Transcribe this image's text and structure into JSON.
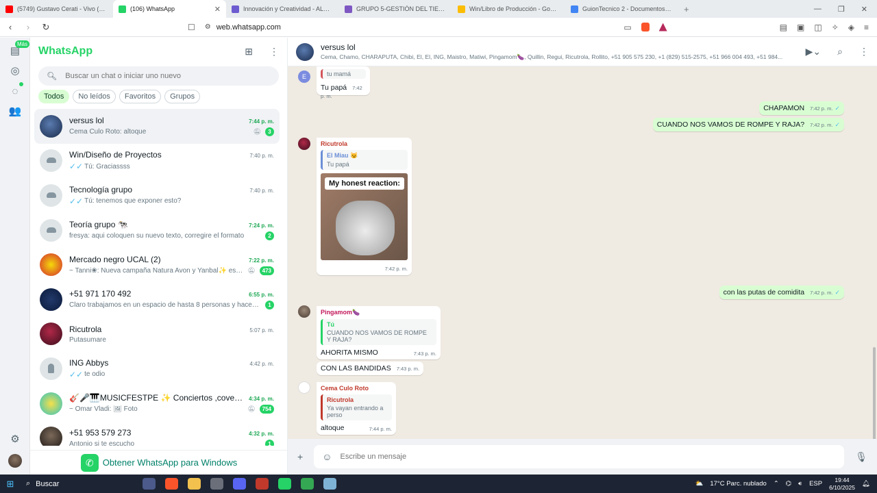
{
  "browser": {
    "tabs": [
      {
        "label": "(5749) Gustavo Cerati - Vivo (Oficial",
        "color": "#ff0000",
        "active": false
      },
      {
        "label": "(106) WhatsApp",
        "color": "#25d366",
        "active": true
      },
      {
        "label": "Innovación y Creatividad - ALUMNO",
        "color": "#6d5bd0",
        "active": false
      },
      {
        "label": "GRUPO 5-GESTIÓN DEL TIEMPO - Pr",
        "color": "#7e57c2",
        "active": false
      },
      {
        "label": "Win/Libro de Producción - Google D",
        "color": "#fbbc04",
        "active": false
      },
      {
        "label": "GuionTecnico 2 - Documentos de Go",
        "color": "#4285f4",
        "active": false
      }
    ],
    "url": "web.whatsapp.com"
  },
  "sidebar": {
    "title": "WhatsApp",
    "mas_badge": "Más",
    "search_placeholder": "Buscar un chat o iniciar uno nuevo",
    "filters": [
      "Todos",
      "No leídos",
      "Favoritos",
      "Grupos"
    ],
    "chats": [
      {
        "name": "versus lol",
        "time": "7:44 p. m.",
        "preview": "Cema Culo Roto: altoque",
        "badge": "3",
        "muted": true,
        "unread": true,
        "avatar": "radial-gradient(circle at 45% 40%, #5a7bb0, #1a2b4a)",
        "type": "img"
      },
      {
        "name": "Win/Diseño de Proyectos",
        "time": "7:40 p. m.",
        "preview": "Tú: Graciassss",
        "badge": "",
        "muted": false,
        "unread": false,
        "ticks": true,
        "type": "grp"
      },
      {
        "name": "Tecnología grupo",
        "time": "7:40 p. m.",
        "preview": "Tú: tenemos que exponer esto?",
        "badge": "",
        "muted": false,
        "unread": false,
        "ticks": true,
        "type": "grp"
      },
      {
        "name": "Teoría grupo 🐄",
        "time": "7:24 p. m.",
        "preview": "fresya: aqui coloquen su nuevo texto, corregire el formato",
        "badge": "2",
        "muted": false,
        "unread": true,
        "type": "grp"
      },
      {
        "name": "Mercado negro UCAL (2)",
        "time": "7:22 p. m.",
        "preview": "~ Tanni❀: Nueva campaña Natura Avon y Yanbal✨ escribe...",
        "badge": "473",
        "muted": true,
        "unread": true,
        "avatar": "radial-gradient(circle at 50% 50%, #f5d90a, #d4292f)",
        "type": "img"
      },
      {
        "name": "+51 971 170 492",
        "time": "6:55 p. m.",
        "preview": "Claro trabajamos en un espacio de hasta 8 personas y hacemos e...",
        "badge": "1",
        "muted": false,
        "unread": true,
        "avatar": "radial-gradient(circle at 50% 50%, #223a6b, #0b1a3a)",
        "type": "img"
      },
      {
        "name": "Ricutrola",
        "time": "5:07 p. m.",
        "preview": "Putasumare",
        "badge": "",
        "muted": false,
        "unread": false,
        "avatar": "radial-gradient(circle at 45% 40%, #b02848, #3a0e1c)",
        "type": "img"
      },
      {
        "name": "ING Abbys",
        "time": "4:42 p. m.",
        "preview": "te odio",
        "badge": "",
        "muted": false,
        "unread": false,
        "ticks": true,
        "type": "person"
      },
      {
        "name": "🎸🎤🎹MUSICFESTPE ✨ Conciertos ,covers nacio...",
        "time": "4:34 p. m.",
        "preview": "~ Omar Vladi: 🖼 Foto",
        "badge": "754",
        "muted": true,
        "unread": true,
        "avatar": "radial-gradient(circle at 50% 50%, #f5e04a, #2ec4c4)",
        "type": "img"
      },
      {
        "name": "+51 953 579 273",
        "time": "4:32 p. m.",
        "preview": "Antonio si te escucho",
        "badge": "1",
        "muted": false,
        "unread": true,
        "avatar": "radial-gradient(circle at 50% 40%, #7c6a5a, #1c1714)",
        "type": "img"
      }
    ],
    "get_windows": "Obtener WhatsApp para Windows"
  },
  "conversation": {
    "name": "versus lol",
    "members": "Cema, Chamo, CHARAPUTA, Chibi, El, El, ING, Maistro, Matiwi, Pingamom🍆, Quillin, Regui, Ricutrola, Rollito, +51 905 575 230, +1 (829) 515-2575, +51 966 004 493, +51 984...",
    "composer_placeholder": "Escribe un mensaje",
    "messages": {
      "m1_quote": "tu mamá",
      "m1_text": "Tu papá",
      "m1_time": "7:42 p. m.",
      "m1_avatar_letter": "E",
      "o1_text": "CHAPAMON",
      "o1_time": "7:42 p. m.",
      "o2_text": "CUANDO NOS VAMOS DE ROMPE Y RAJA?",
      "o2_time": "7:42 p. m.",
      "m2_sender": "Ricutrola",
      "m2_quote_name": "El Miau 😼",
      "m2_quote_text": "Tu papá",
      "m2_sticker_caption": "My honest reaction:",
      "m2_time": "7:42 p. m.",
      "o3_text": "con las putas de comidita",
      "o3_time": "7:42 p. m.",
      "m3_sender": "Pingamom🍆",
      "m3_quote_name": "Tú",
      "m3_quote_text": "CUANDO NOS VAMOS DE ROMPE Y RAJA?",
      "m3_text": "AHORITA MISMO",
      "m3_time": "7:43 p. m.",
      "m4_text": "CON LAS BANDIDAS",
      "m4_time": "7:43 p. m.",
      "m5_sender": "Cema Culo Roto",
      "m5_quote_name": "Ricutrola",
      "m5_quote_text": "Ya vayan entrando a perso",
      "m5_text": "altoque",
      "m5_time": "7:44 p. m."
    }
  },
  "taskbar": {
    "search": "Buscar",
    "weather": "17°C  Parc. nublado",
    "lang": "ESP",
    "time": "19:44",
    "date": "6/10/2025"
  },
  "colors": {
    "accent": "#25d366",
    "outgoing": "#d9fdd3",
    "background": "#efeae2"
  }
}
